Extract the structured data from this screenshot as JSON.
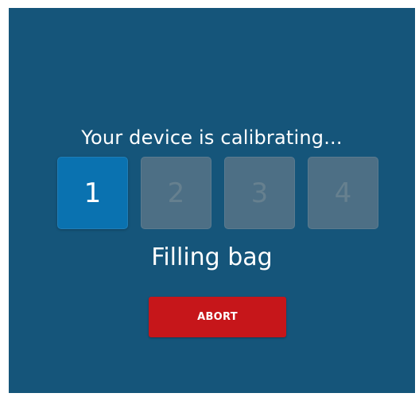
{
  "calibration": {
    "title": "Your device is calibrating...",
    "current_step": 1,
    "steps": [
      {
        "label": "1",
        "state": "active"
      },
      {
        "label": "2",
        "state": "inactive"
      },
      {
        "label": "3",
        "state": "inactive"
      },
      {
        "label": "4",
        "state": "inactive"
      }
    ],
    "status": "Filling bag",
    "abort_label": "ABORT"
  },
  "colors": {
    "background": "#15557a",
    "step_active": "#0a72b0",
    "step_inactive": "#4d6f85",
    "abort_button": "#c6161a"
  }
}
